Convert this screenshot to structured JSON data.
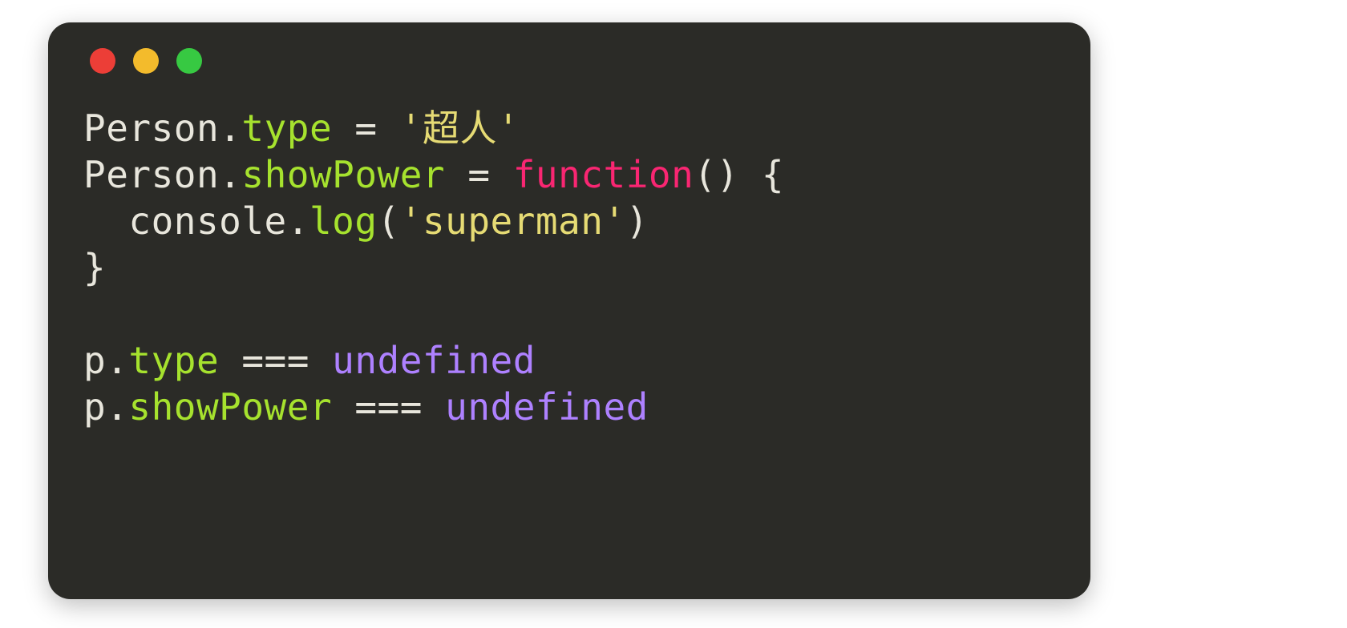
{
  "theme": {
    "window_bg": "#2b2b27",
    "page_bg": "#ffffff",
    "traffic_red": "#ec3e37",
    "traffic_yellow": "#f3bb2c",
    "traffic_green": "#37c942",
    "text_default": "#e8e6dc",
    "text_prop": "#a6e22e",
    "text_string": "#e6db74",
    "text_keyword": "#f92672",
    "text_builtin": "#ae81ff"
  },
  "code_tokens": [
    [
      {
        "cls": "tok-plain",
        "t": "Person."
      },
      {
        "cls": "tok-prop",
        "t": "type"
      },
      {
        "cls": "tok-plain",
        "t": " = "
      },
      {
        "cls": "tok-string",
        "t": "'超人'"
      }
    ],
    [
      {
        "cls": "tok-plain",
        "t": "Person."
      },
      {
        "cls": "tok-prop",
        "t": "showPower"
      },
      {
        "cls": "tok-plain",
        "t": " = "
      },
      {
        "cls": "tok-keyword",
        "t": "function"
      },
      {
        "cls": "tok-plain",
        "t": "() {"
      }
    ],
    [
      {
        "cls": "tok-plain",
        "t": "  console."
      },
      {
        "cls": "tok-prop",
        "t": "log"
      },
      {
        "cls": "tok-plain",
        "t": "("
      },
      {
        "cls": "tok-string",
        "t": "'superman'"
      },
      {
        "cls": "tok-plain",
        "t": ")"
      }
    ],
    [
      {
        "cls": "tok-plain",
        "t": "}"
      }
    ],
    [
      {
        "cls": "tok-plain",
        "t": ""
      }
    ],
    [
      {
        "cls": "tok-plain",
        "t": "p."
      },
      {
        "cls": "tok-prop",
        "t": "type"
      },
      {
        "cls": "tok-plain",
        "t": " === "
      },
      {
        "cls": "tok-builtin",
        "t": "undefined"
      }
    ],
    [
      {
        "cls": "tok-plain",
        "t": "p."
      },
      {
        "cls": "tok-prop",
        "t": "showPower"
      },
      {
        "cls": "tok-plain",
        "t": " === "
      },
      {
        "cls": "tok-builtin",
        "t": "undefined"
      }
    ]
  ],
  "code_plain": "Person.type = '超人'\nPerson.showPower = function() {\n  console.log('superman')\n}\n\np.type === undefined\np.showPower === undefined"
}
